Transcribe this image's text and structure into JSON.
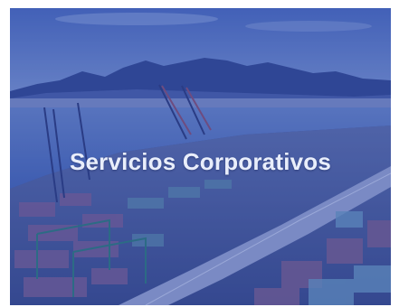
{
  "hero": {
    "title": "Servicios Corporativos",
    "image_subject": "container-port-aerial-photo",
    "overlay_color": "#2846aa"
  }
}
